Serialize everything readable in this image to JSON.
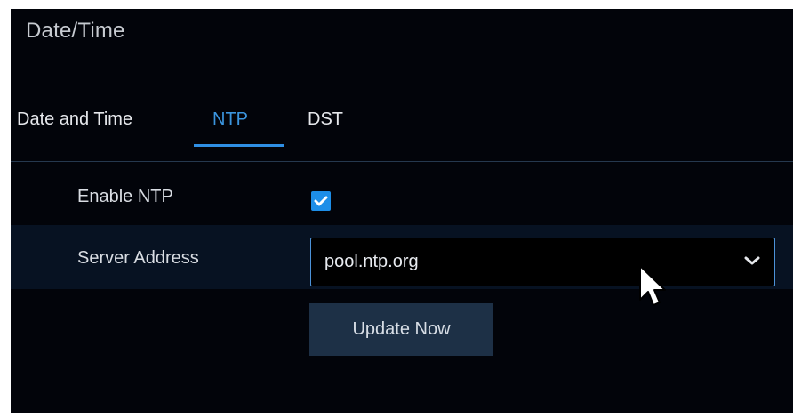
{
  "window": {
    "title": "Date/Time"
  },
  "tabs": [
    {
      "label": "Date and Time",
      "active": false
    },
    {
      "label": "NTP",
      "active": true
    },
    {
      "label": "DST",
      "active": false
    }
  ],
  "form": {
    "enable_ntp": {
      "label": "Enable NTP",
      "checked": true,
      "icon": "checkmark-icon"
    },
    "server_address": {
      "label": "Server Address",
      "value": "pool.ntp.org",
      "icon": "chevron-down-icon"
    },
    "update_button": {
      "label": "Update Now"
    }
  },
  "colors": {
    "background": "#02040a",
    "row_highlight": "#071222",
    "active_tab": "#3b95df",
    "checkbox": "#1d8ee8",
    "button": "#1d3046",
    "select_border": "#4c92d8"
  },
  "cursor": {
    "icon": "mouse-pointer-icon"
  }
}
